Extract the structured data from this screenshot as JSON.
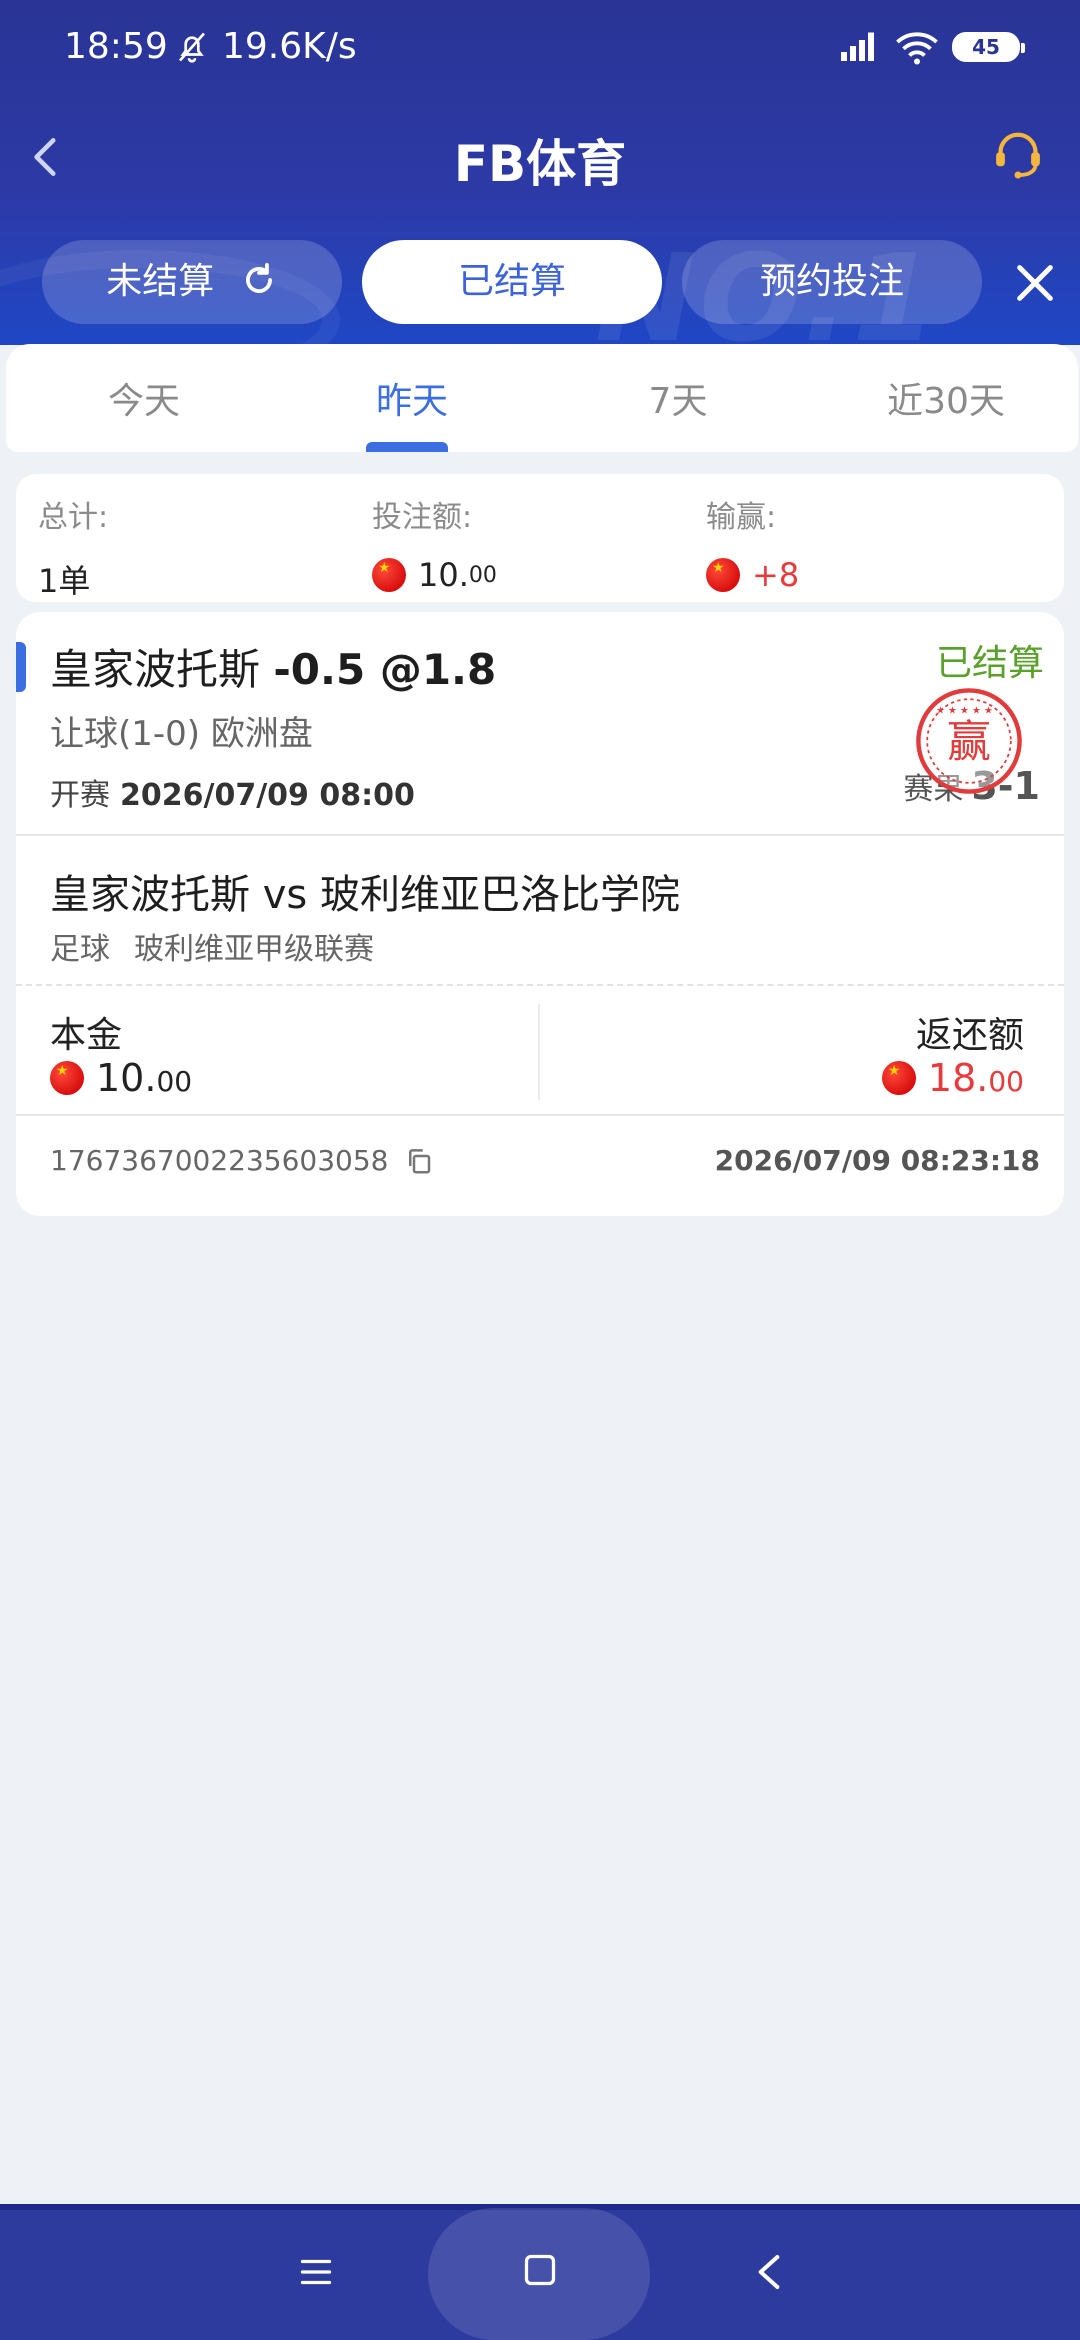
{
  "status_bar": {
    "time": "18:59",
    "net_speed": "19.6K/s",
    "battery": "45"
  },
  "header": {
    "title": "FB体育",
    "watermark": "NO.1",
    "tabs": [
      {
        "label": "未结算"
      },
      {
        "label": "已结算"
      },
      {
        "label": "预约投注"
      }
    ]
  },
  "day_filter": {
    "items": [
      "今天",
      "昨天",
      "7天",
      "近30天"
    ],
    "active_index": 1
  },
  "summary": {
    "total_label": "总计:",
    "total_value": "1单",
    "stake_label": "投注额:",
    "stake_int": "10.",
    "stake_dec": "00",
    "pnl_label": "输赢:",
    "pnl_value": "+8"
  },
  "bet": {
    "selection": "皇家波托斯",
    "odds_line": "-0.5 @1.8",
    "status": "已结算",
    "market": "让球(1-0) 欧洲盘",
    "kickoff_label": "开赛",
    "kickoff_time": "2026/07/09 08:00",
    "result_label": "赛果",
    "result_score": "3-1",
    "stamp_text": "赢",
    "match": "皇家波托斯 vs 玻利维亚巴洛比学院",
    "sport": "足球",
    "league": "玻利维亚甲级联赛",
    "stake_label": "本金",
    "stake_int": "10.",
    "stake_dec": "00",
    "return_label": "返还额",
    "return_int": "18.",
    "return_dec": "00",
    "order_id": "1767367002235603058",
    "order_time": "2026/07/09 08:23:18"
  },
  "colors": {
    "header_bg": "#2d3aa6",
    "accent_blue": "#3b6ee0",
    "win_red": "#e83a3a",
    "settled_green": "#5aa12c"
  },
  "icons": {
    "back": "chevron-left-icon",
    "support": "headset-icon",
    "refresh": "refresh-icon",
    "close": "close-icon",
    "copy": "copy-icon",
    "flag": "cny-flag-icon"
  }
}
